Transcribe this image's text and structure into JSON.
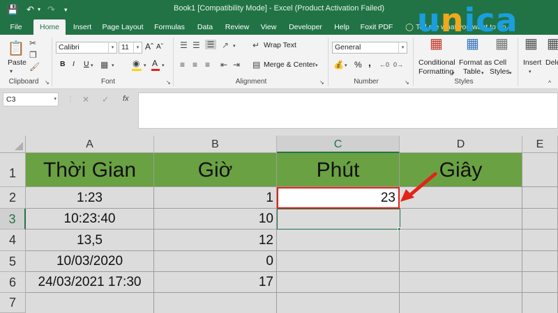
{
  "window": {
    "title": "Book1  [Compatibility Mode]  -  Excel (Product Activation Failed)"
  },
  "brand": {
    "logo_text": "unica",
    "logo_colors": [
      "#1a9ee0",
      "#f0a81c",
      "#1a9ee0",
      "#1a9ee0",
      "#1a9ee0"
    ]
  },
  "tabs": [
    {
      "label": "File"
    },
    {
      "label": "Home"
    },
    {
      "label": "Insert"
    },
    {
      "label": "Page Layout"
    },
    {
      "label": "Formulas"
    },
    {
      "label": "Data"
    },
    {
      "label": "Review"
    },
    {
      "label": "View"
    },
    {
      "label": "Developer"
    },
    {
      "label": "Help"
    },
    {
      "label": "Foxit PDF"
    }
  ],
  "tell_me": "Tell me what you want to do",
  "ribbon": {
    "clipboard": {
      "paste": "Paste",
      "label": "Clipboard"
    },
    "font": {
      "name": "Calibri",
      "size": "11",
      "label": "Font",
      "bold": "B",
      "italic": "I",
      "underline": "U"
    },
    "alignment": {
      "wrap": "Wrap Text",
      "merge": "Merge & Center",
      "label": "Alignment"
    },
    "number": {
      "format": "General",
      "label": "Number",
      "percent": "%",
      "comma": ","
    },
    "styles": {
      "conditional": "Conditional",
      "formatting": "Formatting",
      "format_as": "Format as",
      "table": "Table",
      "cell": "Cell",
      "cell_styles": "Styles",
      "label": "Styles"
    },
    "cells": {
      "insert": "Insert",
      "delete": "Dele"
    }
  },
  "formula_bar": {
    "name_box": "C3",
    "fx": "fx",
    "content": ""
  },
  "sheet": {
    "columns": [
      "A",
      "B",
      "C",
      "D",
      "E"
    ],
    "rows": [
      "1",
      "2",
      "3",
      "4",
      "5",
      "6",
      "7"
    ],
    "headers": [
      "Thời Gian",
      "Giờ",
      "Phút",
      "Giây"
    ],
    "data": [
      {
        "a": "1:23",
        "b": "1",
        "c": "23"
      },
      {
        "a": "10:23:40",
        "b": "10",
        "c": ""
      },
      {
        "a": "13,5",
        "b": "12",
        "c": ""
      },
      {
        "a": "10/03/2020",
        "b": "0",
        "c": ""
      },
      {
        "a": "24/03/2021 17:30",
        "b": "17",
        "c": ""
      }
    ],
    "selected_cell": "C3",
    "highlight_color": "#e2231a",
    "header_fill": "#6aa142"
  }
}
